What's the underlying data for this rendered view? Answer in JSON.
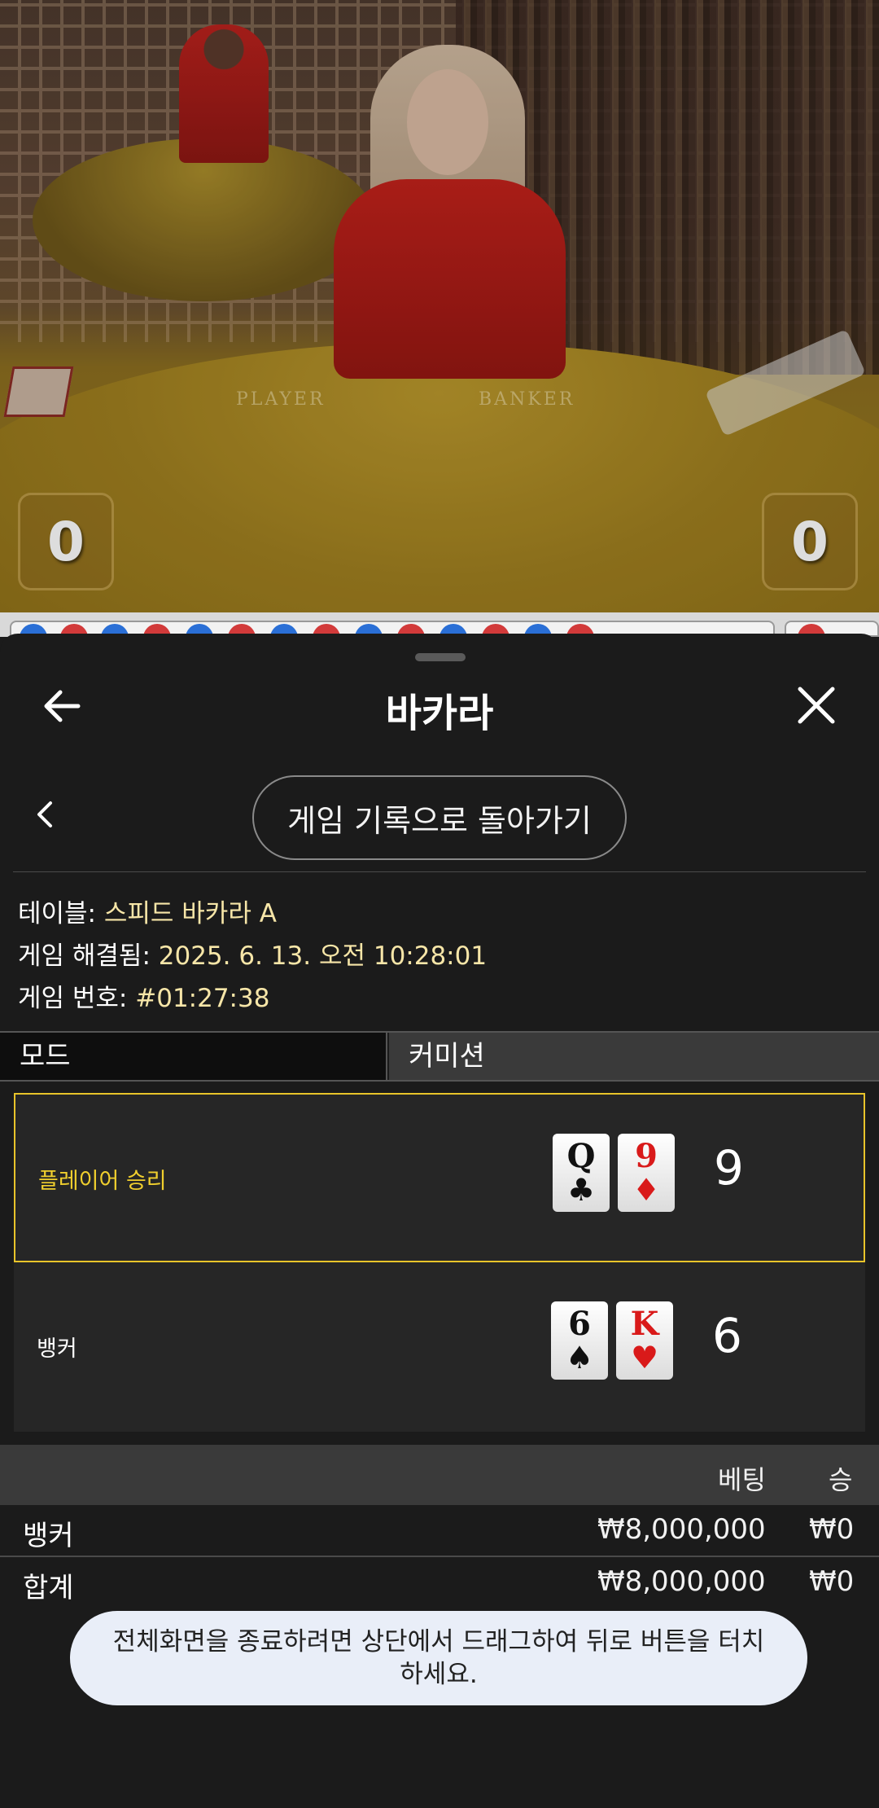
{
  "video": {
    "table_text_player": "PLAYER",
    "table_text_banker": "BANKER",
    "player_score": "0",
    "banker_score": "0"
  },
  "sheet": {
    "title": "바카라",
    "back_to_history_label": "게임 기록으로 돌아가기",
    "info": {
      "table_label": "테이블:",
      "table_value": "스피드 바카라 A",
      "resolved_label": "게임 해결됨:",
      "resolved_value": "2025. 6. 13. 오전 10:28:01",
      "game_no_label": "게임 번호:",
      "game_no_value": "#01:27:38"
    },
    "mode": {
      "label": "모드",
      "value": "커미션"
    },
    "results": [
      {
        "label": "플레이어 승리",
        "winner": true,
        "cards": [
          {
            "rank": "Q",
            "suit": "♣",
            "color": "black"
          },
          {
            "rank": "9",
            "suit": "♦",
            "color": "red"
          }
        ],
        "total": "9"
      },
      {
        "label": "뱅커",
        "winner": false,
        "cards": [
          {
            "rank": "6",
            "suit": "♠",
            "color": "black"
          },
          {
            "rank": "K",
            "suit": "♥",
            "color": "red"
          }
        ],
        "total": "6"
      }
    ],
    "bets": {
      "headers": {
        "bet": "베팅",
        "win": "승"
      },
      "rows": [
        {
          "name": "뱅커",
          "bet": "₩8,000,000",
          "win": "₩0"
        }
      ],
      "total": {
        "name": "합계",
        "bet": "₩8,000,000",
        "win": "₩0"
      }
    },
    "toast": "전체화면을 종료하려면 상단에서 드래그하여 뒤로 버튼을 터치하세요."
  },
  "colors": {
    "accent_gold": "#e8c42a",
    "info_value": "#f7e6a8",
    "sheet_bg": "#1b1b1b"
  },
  "icons": [
    "arrow-left-icon",
    "close-icon",
    "chevron-left-icon"
  ]
}
